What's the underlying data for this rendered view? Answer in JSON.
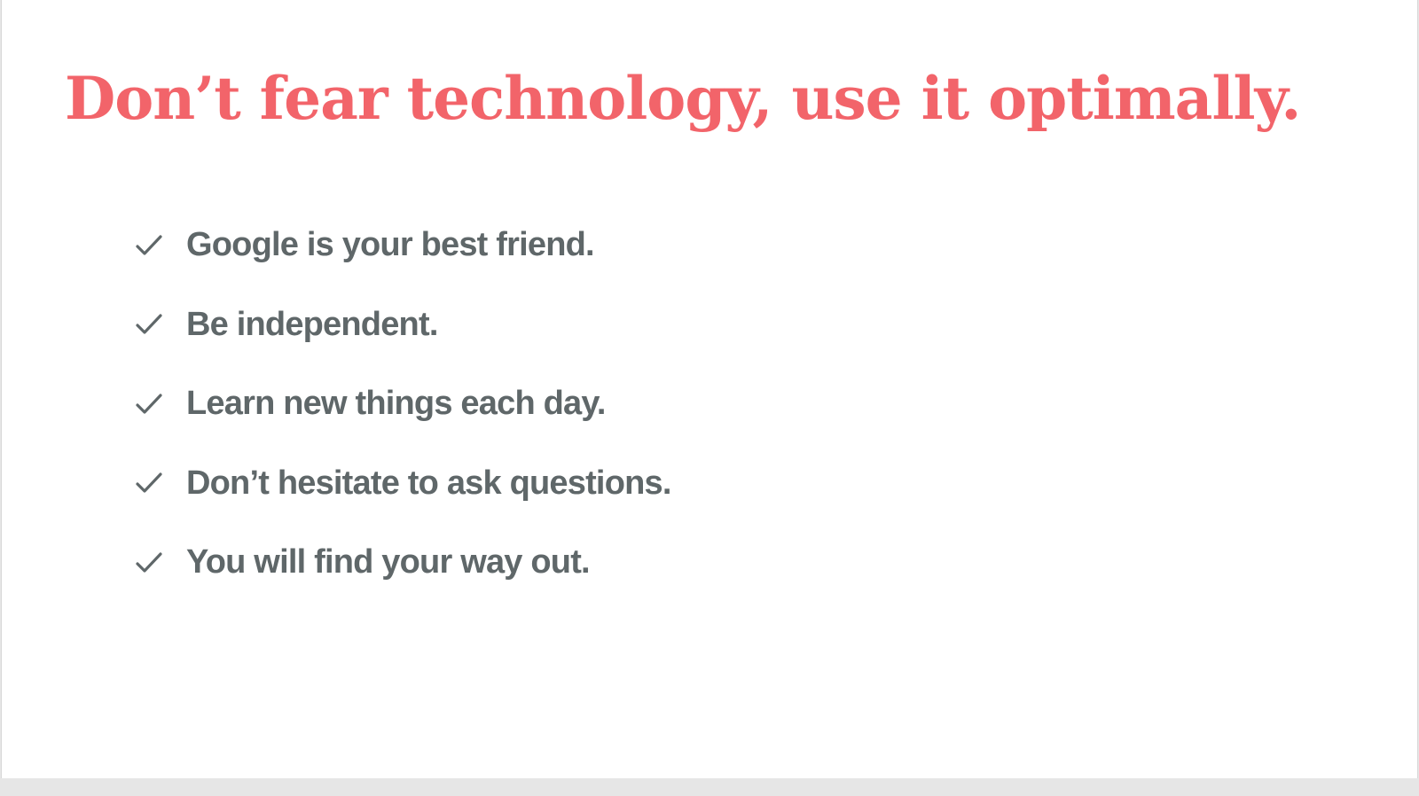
{
  "colors": {
    "title": "#f2646a",
    "body_text": "#5f6769",
    "check": "#5f6769"
  },
  "slide": {
    "title": "Don’t fear technology, use it optimally.",
    "bullet_icon": "checkmark-icon",
    "bullets": [
      "Google is your best friend.",
      "Be independent.",
      "Learn new things each day.",
      "Don’t hesitate to ask questions.",
      "You will find your way out."
    ]
  }
}
